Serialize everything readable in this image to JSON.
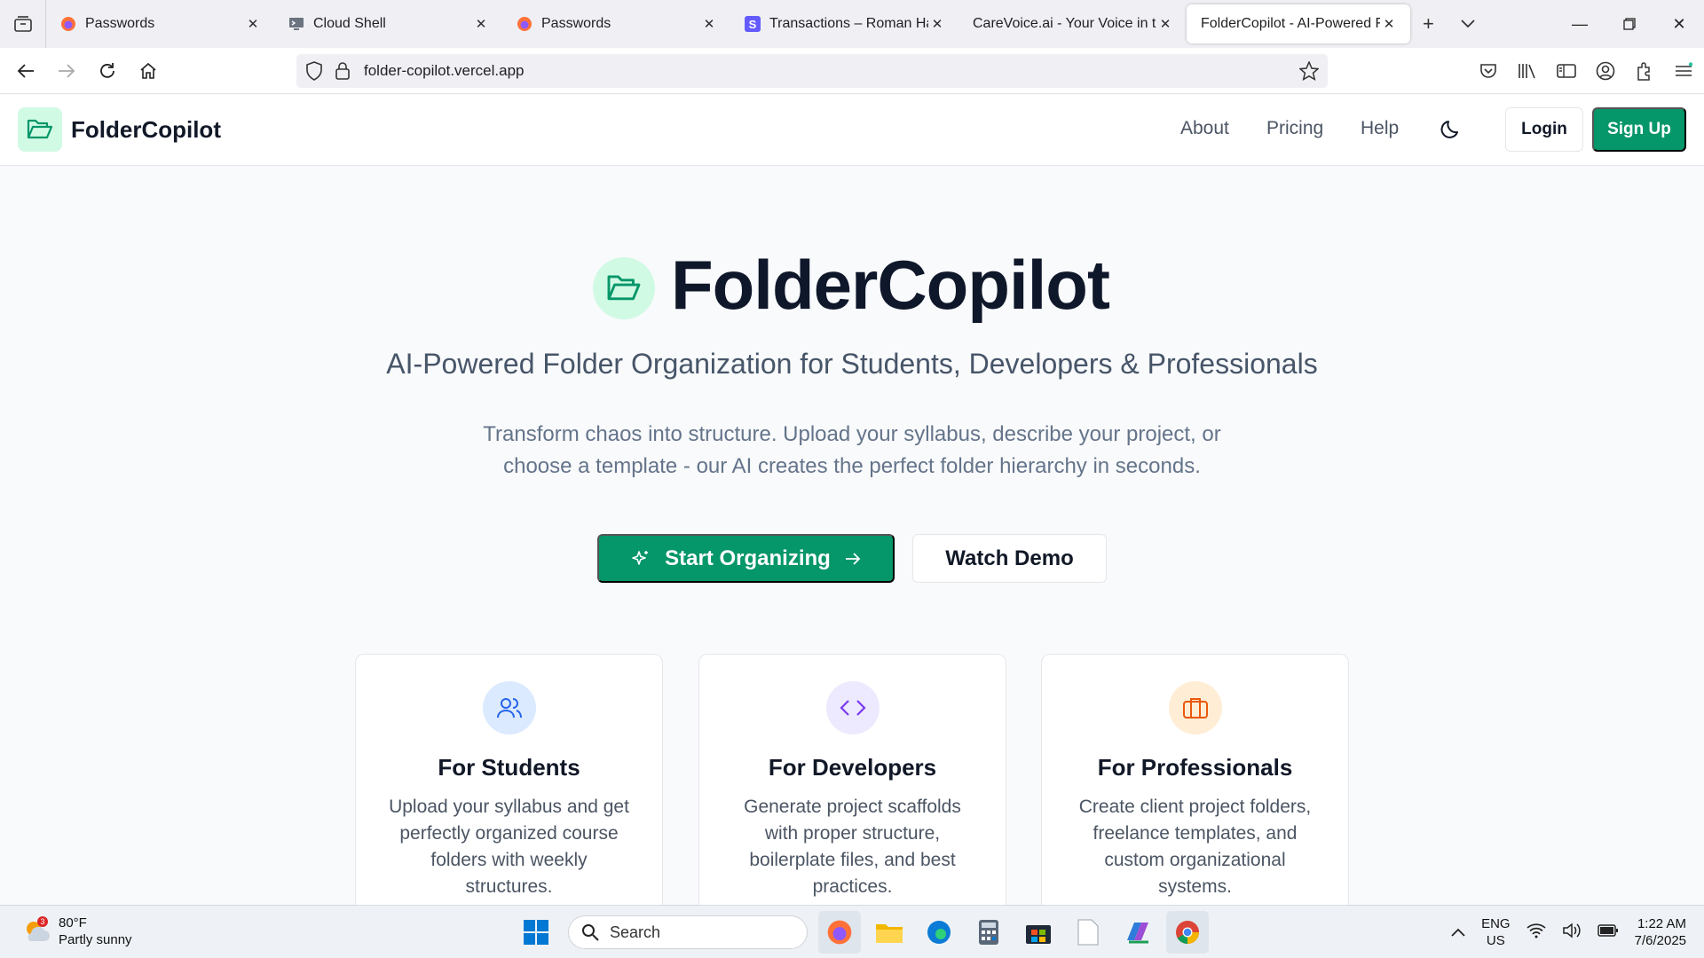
{
  "browser": {
    "tabs": [
      {
        "title": "Passwords",
        "icon": "firefox-icon",
        "active": false
      },
      {
        "title": "Cloud Shell",
        "icon": "cloud-shell-icon",
        "active": false
      },
      {
        "title": "Passwords",
        "icon": "firefox-icon",
        "active": false
      },
      {
        "title": "Transactions – Roman Hance",
        "icon": "stripe-icon",
        "active": false
      },
      {
        "title": "CareVoice.ai - Your Voice in the H",
        "icon": "none",
        "active": false
      },
      {
        "title": "FolderCopilot - AI-Powered Folde",
        "icon": "none",
        "active": true
      }
    ],
    "url": "folder-copilot.vercel.app"
  },
  "site": {
    "brand": "FolderCopilot",
    "nav": {
      "about": "About",
      "pricing": "Pricing",
      "help": "Help"
    },
    "login": "Login",
    "signup": "Sign Up",
    "accent": "#059669"
  },
  "hero": {
    "title": "FolderCopilot",
    "subtitle": "AI-Powered Folder Organization for Students, Developers & Professionals",
    "desc_line1": "Transform chaos into structure. Upload your syllabus, describe your project, or",
    "desc_line2": "choose a template - our AI creates the perfect folder hierarchy in seconds.",
    "cta_primary": "Start Organizing",
    "cta_secondary": "Watch Demo"
  },
  "cards": [
    {
      "title": "For Students",
      "line1": "Upload your syllabus and get",
      "line2": "perfectly organized course",
      "line3": "folders with weekly",
      "line4": "structures.",
      "icon": "users-icon",
      "tint": "#dbeafe"
    },
    {
      "title": "For Developers",
      "line1": "Generate project scaffolds",
      "line2": "with proper structure,",
      "line3": "boilerplate files, and best",
      "line4": "practices.",
      "icon": "code-icon",
      "tint": "#ede9fe"
    },
    {
      "title": "For Professionals",
      "line1": "Create client project folders,",
      "line2": "freelance templates, and",
      "line3": "custom organizational",
      "line4": "systems.",
      "icon": "briefcase-icon",
      "tint": "#ffedd5"
    }
  ],
  "taskbar": {
    "weather_temp": "80°F",
    "weather_desc": "Partly sunny",
    "weather_badge": "3",
    "search_placeholder": "Search",
    "lang_top": "ENG",
    "lang_bottom": "US",
    "time": "1:22 AM",
    "date": "7/6/2025"
  }
}
